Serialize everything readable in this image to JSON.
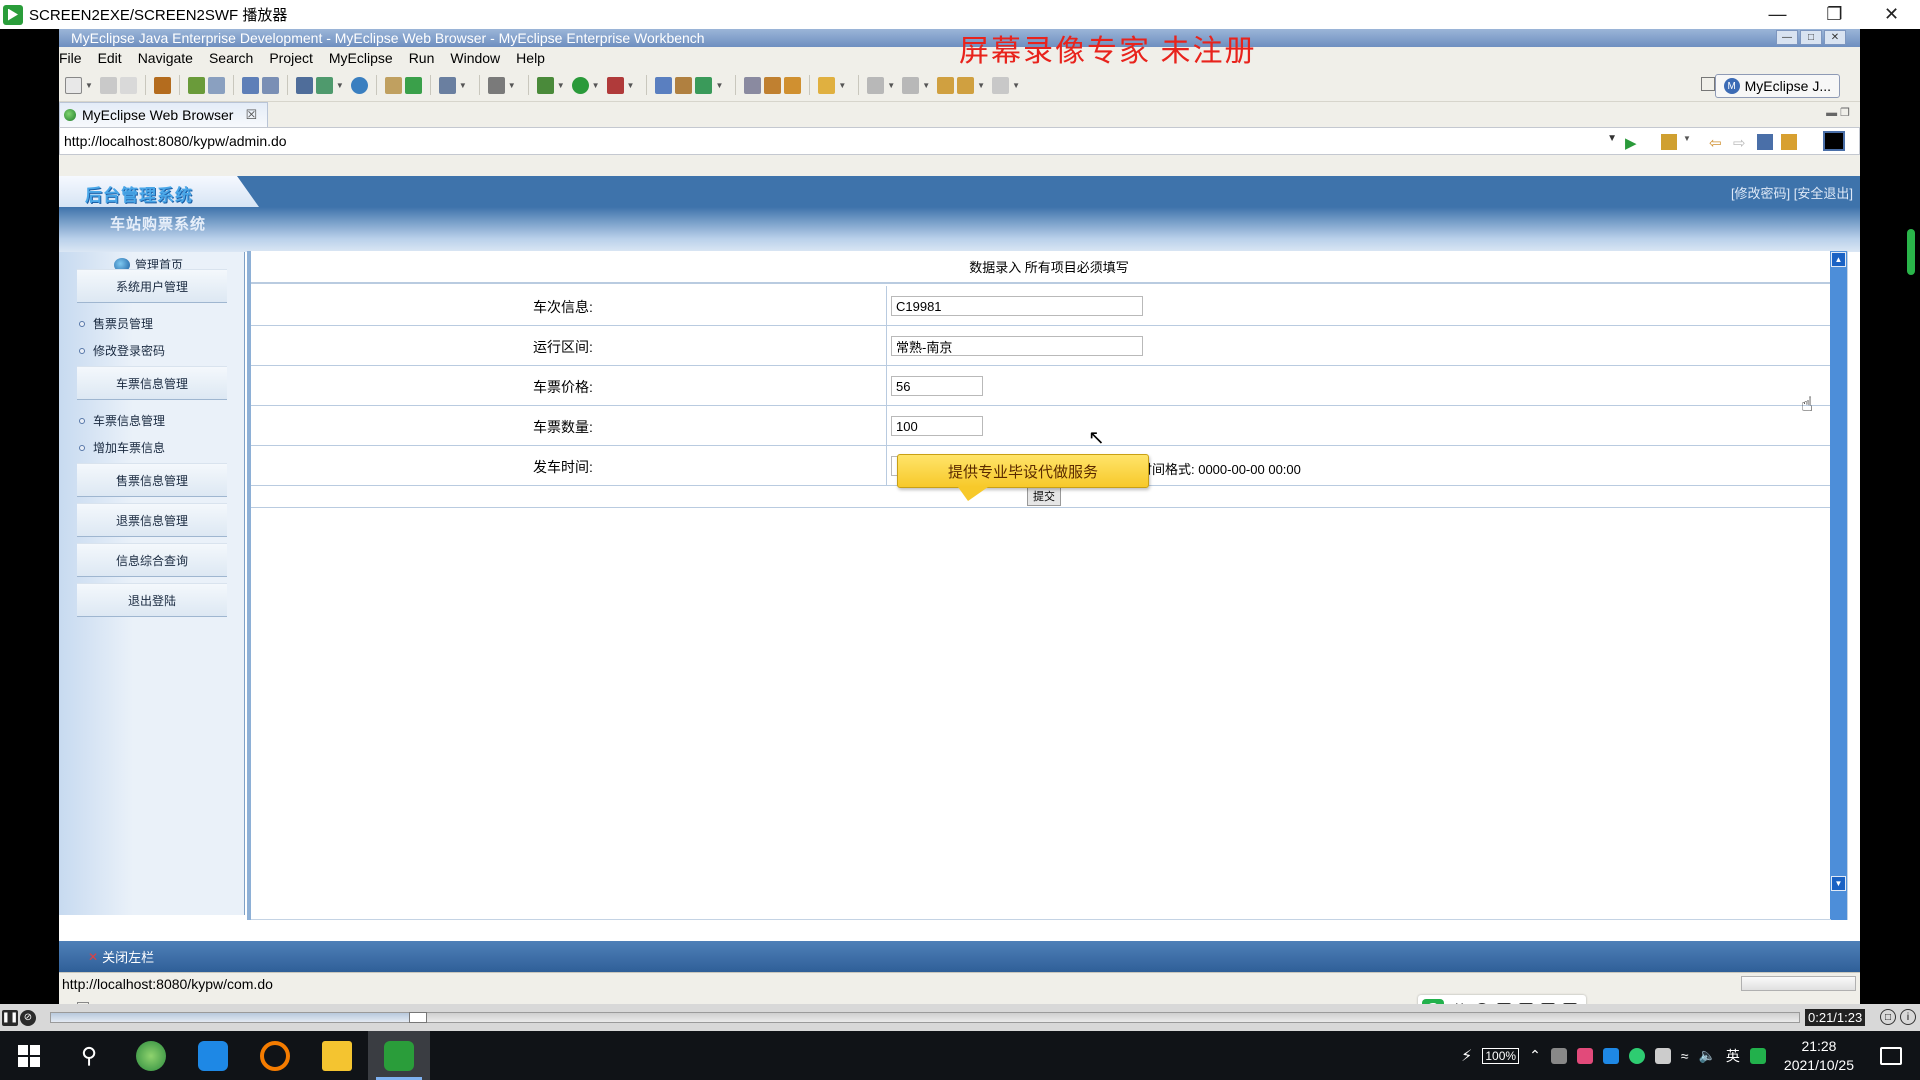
{
  "player": {
    "title": "SCREEN2EXE/SCREEN2SWF 播放器",
    "time": "0:21/1:23",
    "progress_fraction": 0.21
  },
  "ide": {
    "window_title": "MyEclipse Java Enterprise Development - MyEclipse Web Browser - MyEclipse Enterprise Workbench",
    "watermark": "屏幕录像专家  未注册",
    "menu": [
      "File",
      "Edit",
      "Navigate",
      "Search",
      "Project",
      "MyEclipse",
      "Run",
      "Window",
      "Help"
    ],
    "perspective": "MyEclipse J...",
    "editor_tab": "MyEclipse Web Browser",
    "url": "http://localhost:8080/kypw/admin.do",
    "status_url": "http://localhost:8080/kypw/com.do"
  },
  "page": {
    "logo": "后台管理系统",
    "header_links": "[修改密码] [安全退出]",
    "system_name": "车站购票系统",
    "nav": {
      "home": "管理首页",
      "sections": [
        {
          "label": "系统用户管理",
          "items": [
            "售票员管理",
            "修改登录密码"
          ]
        },
        {
          "label": "车票信息管理",
          "items": [
            "车票信息管理",
            "增加车票信息"
          ]
        },
        {
          "label": "售票信息管理",
          "items": []
        },
        {
          "label": "退票信息管理",
          "items": []
        },
        {
          "label": "信息综合查询",
          "items": []
        },
        {
          "label": "退出登陆",
          "items": []
        }
      ]
    },
    "form": {
      "heading": "数据录入  所有项目必须填写",
      "fields": [
        {
          "label": "车次信息:",
          "value": "C19981"
        },
        {
          "label": "运行区间:",
          "value": "常熟-南京"
        },
        {
          "label": "车票价格:",
          "value": "56"
        },
        {
          "label": "车票数量:",
          "value": "100"
        },
        {
          "label": "发车时间:",
          "value": ""
        }
      ],
      "time_hint": "时间格式: 0000-00-00 00:00",
      "submit_label": "提交",
      "tooltip": "提供专业毕设代做服务"
    },
    "footer_close_left": "关闭左栏"
  },
  "ime": {
    "lang": "英"
  },
  "taskbar": {
    "battery": "100%",
    "tray_lang": "英",
    "clock_time": "21:28",
    "clock_date": "2021/10/25"
  }
}
